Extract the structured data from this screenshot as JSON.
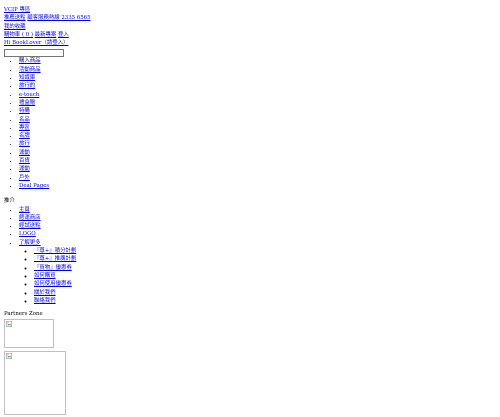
{
  "header": {
    "top_link": "VCIP 專區",
    "row2_links": [
      "推薦送點",
      "顧客服務熱線 2335 6565"
    ],
    "row3_links": [
      "我的收藏"
    ],
    "row4_links": [
      "購物車 ( 0 )",
      "最新專案",
      "登入"
    ],
    "greeting": "Hi BookLover（請登入）"
  },
  "search": {
    "value": "",
    "placeholder": ""
  },
  "categories": [
    "購入商品",
    "活動商品",
    "知識庫",
    "旅行的",
    "e-touch",
    "禮盒贈",
    "特購",
    "名品",
    "專區",
    "名牌",
    "旅行",
    "運動",
    "百貨",
    "運動",
    "戶外",
    "Deal Pages"
  ],
  "section_title": "推介",
  "service_links": [
    "主頁",
    "館運商店",
    "經試送點",
    "LOGO",
    "了解更多"
  ],
  "sub_links": [
    "『尊+』積分計劃",
    "『尊+』推廣計劃",
    "『買物』優惠券",
    "如何購買",
    "如何使用優惠券",
    "關於我們",
    "聯絡我們"
  ],
  "partners_label": "Partners Zone"
}
